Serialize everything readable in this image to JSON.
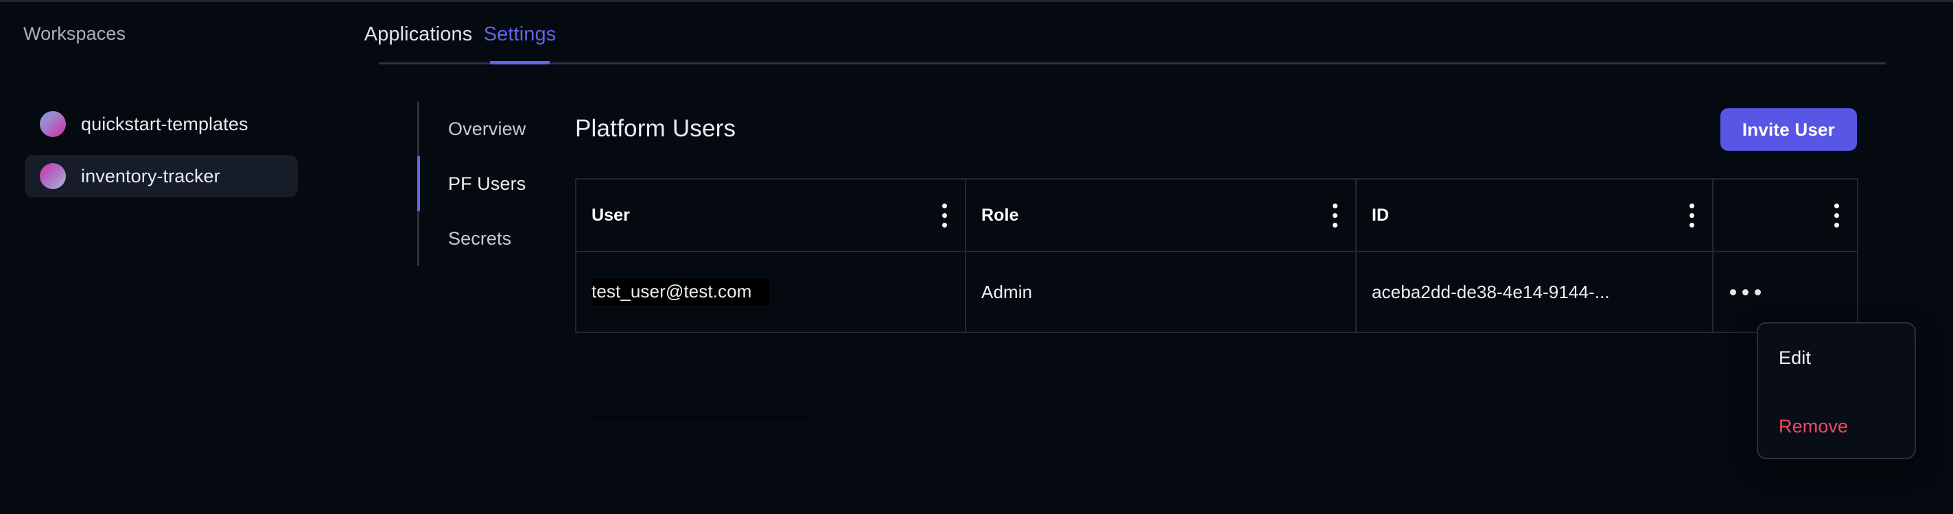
{
  "sidebar": {
    "section_label": "Workspaces",
    "items": [
      {
        "label": "quickstart-templates",
        "avatar": "workspace-avatar-gradient",
        "selected": false
      },
      {
        "label": "inventory-tracker",
        "avatar": "workspace-avatar-gradient",
        "selected": true
      }
    ]
  },
  "tabs": [
    {
      "label": "Applications",
      "active": false
    },
    {
      "label": "Settings",
      "active": true
    }
  ],
  "subnav": {
    "items": [
      {
        "label": "Overview",
        "active": false
      },
      {
        "label": "PF Users",
        "active": true
      },
      {
        "label": "Secrets",
        "active": false
      }
    ]
  },
  "main": {
    "title": "Platform Users",
    "invite_button": "Invite User",
    "table": {
      "columns": [
        {
          "header": "User",
          "menu_icon": "kebab-vertical-icon"
        },
        {
          "header": "Role",
          "menu_icon": "kebab-vertical-icon"
        },
        {
          "header": "ID",
          "menu_icon": "kebab-vertical-icon"
        },
        {
          "header": "",
          "menu_icon": "kebab-vertical-icon"
        }
      ],
      "rows": [
        {
          "user": "test_user@test.com",
          "role": "Admin",
          "id": "aceba2dd-de38-4e14-9144-...",
          "actions_icon": "kebab-horizontal-icon"
        }
      ]
    }
  },
  "dropdown": {
    "items": [
      {
        "label": "Edit",
        "variant": "default"
      },
      {
        "label": "Remove",
        "variant": "danger"
      }
    ]
  },
  "colors": {
    "background": "#050910",
    "accent": "#5856e4",
    "accent_text": "#6165e8",
    "danger": "#ef4a60",
    "border": "#202834",
    "selected_row": "#161c28",
    "text_primary": "#e9ecf1",
    "text_muted": "#a8b0bd"
  }
}
